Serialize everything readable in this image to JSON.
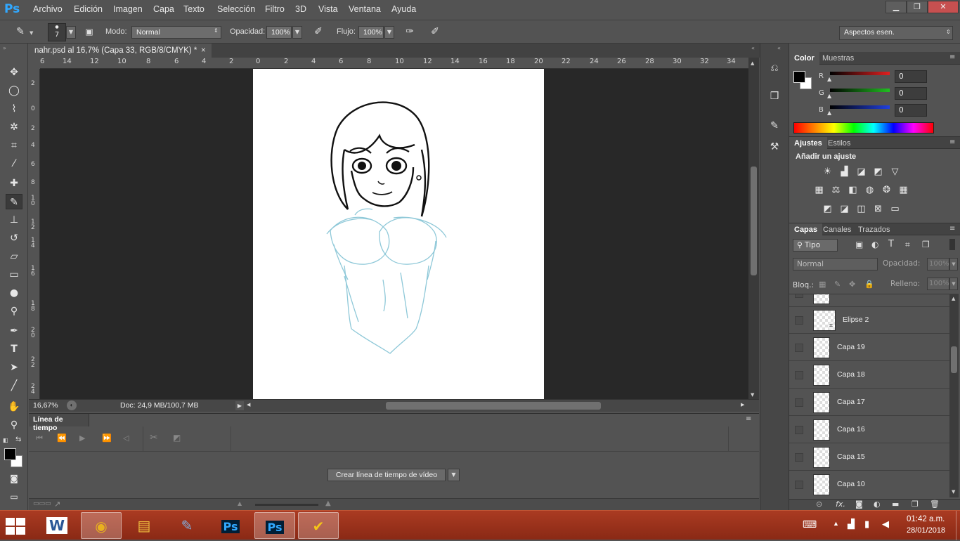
{
  "app": {
    "logo": "Ps"
  },
  "menu": [
    "Archivo",
    "Edición",
    "Imagen",
    "Capa",
    "Texto",
    "Selección",
    "Filtro",
    "3D",
    "Vista",
    "Ventana",
    "Ayuda"
  ],
  "window_controls": {
    "minimize": "▁",
    "restore": "❐",
    "close": "✕"
  },
  "options_bar": {
    "brush_size": "7",
    "mode_label": "Modo:",
    "mode_value": "Normal",
    "opacity_label": "Opacidad:",
    "opacity_value": "100%",
    "flow_label": "Flujo:",
    "flow_value": "100%",
    "workspace": "Aspectos esen."
  },
  "document": {
    "tab_title": "nahr.psd al 16,7% (Capa 33, RGB/8/CMYK) *",
    "close": "×",
    "ruler_top": [
      "6",
      "14",
      "12",
      "10",
      "8",
      "6",
      "4",
      "2",
      "0",
      "2",
      "4",
      "6",
      "8",
      "10",
      "12",
      "14",
      "16",
      "18",
      "20",
      "22",
      "24",
      "26",
      "28",
      "30",
      "32",
      "34"
    ],
    "ruler_left": [
      "2",
      "0",
      "2",
      "4",
      "6",
      "8",
      "1 0",
      "1 2",
      "1 4",
      "1 6",
      "1 8",
      "2 0",
      "2 2",
      "2 4"
    ],
    "zoom": "16,67%",
    "doc_info": "Doc: 24,9 MB/100,7 MB"
  },
  "timeline": {
    "title": "Línea de tiempo",
    "create_button": "Crear línea de tiempo de vídeo"
  },
  "color_panel": {
    "tabs": [
      "Color",
      "Muestras"
    ],
    "channels": [
      {
        "label": "R",
        "value": "0",
        "color": "#e02020"
      },
      {
        "label": "G",
        "value": "0",
        "color": "#20c020"
      },
      {
        "label": "B",
        "value": "0",
        "color": "#2040e0"
      }
    ]
  },
  "adjustments_panel": {
    "tabs": [
      "Ajustes",
      "Estilos"
    ],
    "heading": "Añadir un ajuste"
  },
  "layers_panel": {
    "tabs": [
      "Capas",
      "Canales",
      "Trazados"
    ],
    "filter_kind": "Tipo",
    "blend_mode": "Normal",
    "opacity_label": "Opacidad:",
    "opacity_value": "100%",
    "lock_label": "Bloq.:",
    "fill_label": "Relleno:",
    "fill_value": "100%",
    "layers": [
      {
        "name": "Elipse 2"
      },
      {
        "name": "Capa 19"
      },
      {
        "name": "Capa 18"
      },
      {
        "name": "Capa 17"
      },
      {
        "name": "Capa 16"
      },
      {
        "name": "Capa 15"
      },
      {
        "name": "Capa 10"
      }
    ],
    "footer_icons": [
      "link-icon",
      "fx-icon",
      "mask-icon",
      "adjustment-icon",
      "folder-icon",
      "new-layer-icon",
      "trash-icon"
    ],
    "fx_label": "fx."
  },
  "taskbar": {
    "apps": [
      {
        "name": "word",
        "label": "W",
        "color": "#2b5797"
      },
      {
        "name": "chrome",
        "label": "◉",
        "color": "#e8b020"
      },
      {
        "name": "explorer",
        "label": "▤",
        "color": "#f0c040"
      },
      {
        "name": "paint",
        "label": "✎",
        "color": "#80b0e0"
      },
      {
        "name": "photoshop-1",
        "label": "Ps",
        "color": "#31a8ff"
      },
      {
        "name": "photoshop-2",
        "label": "Ps",
        "color": "#31a8ff"
      },
      {
        "name": "norton",
        "label": "✔",
        "color": "#f5c518"
      }
    ],
    "time": "01:42 a.m.",
    "date": "28/01/2018"
  }
}
